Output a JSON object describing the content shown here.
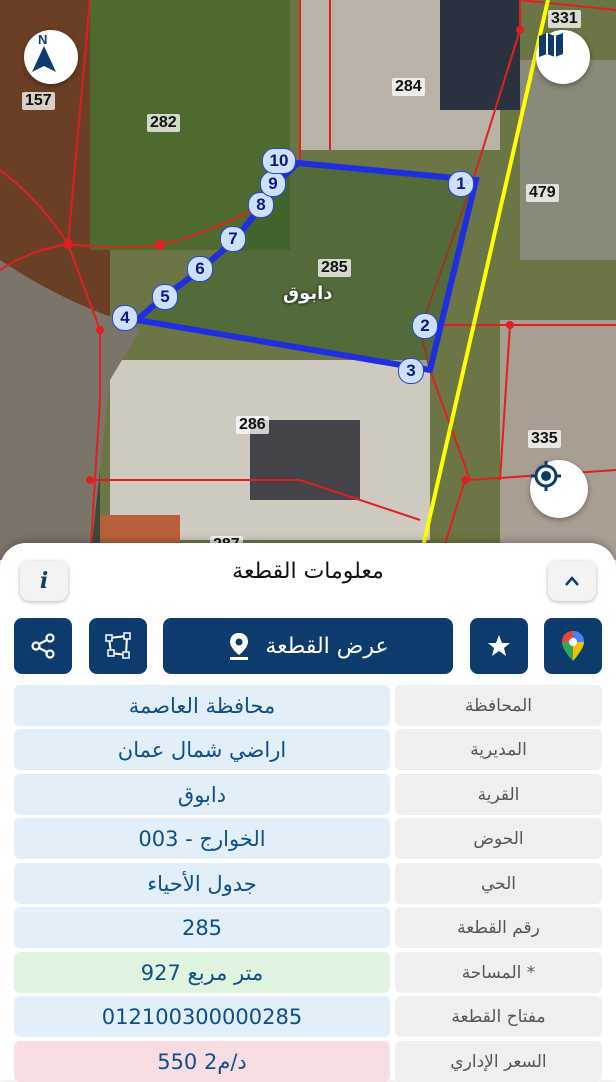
{
  "map": {
    "plot_numbers": {
      "p331": "331",
      "p157": "157",
      "p284": "284",
      "p282": "282",
      "p479": "479",
      "p285": "285",
      "p286": "286",
      "p335": "335",
      "p287": "287"
    },
    "village_label": "دابوق",
    "vertices": [
      "1",
      "2",
      "3",
      "4",
      "5",
      "6",
      "7",
      "8",
      "9",
      "10"
    ],
    "north_label": "N",
    "colors": {
      "boundary": "#1f2fe0",
      "parcel_lines": "#e02020",
      "road": "#ffff00"
    }
  },
  "panel": {
    "title": "معلومات القطعة",
    "info_icon": "i",
    "show_plot_label": "عرض القطعة",
    "icons": [
      "share-icon",
      "polygon-icon",
      "location-pin-icon",
      "star-icon",
      "google-maps-icon",
      "chevron-up-icon",
      "info-icon"
    ],
    "rows": [
      {
        "label": "المحافظة",
        "value": "محافظة العاصمة",
        "color": "#e2eef8"
      },
      {
        "label": "المديرية",
        "value": "اراضي شمال عمان",
        "color": "#e2eef8"
      },
      {
        "label": "القرية",
        "value": "دابوق",
        "color": "#e2eef8"
      },
      {
        "label": "الحوض",
        "value": "الخوارج - 003",
        "color": "#e2eef8"
      },
      {
        "label": "الحي",
        "value": "جدول الأحياء",
        "color": "#e2eef8"
      },
      {
        "label": "رقم القطعة",
        "value": "285",
        "color": "#e2eef8"
      },
      {
        "label": "المساحة *",
        "value": "927  متر مربع",
        "color": "#e0f3df"
      },
      {
        "label": "مفتاح القطعة",
        "value": "012100300000285",
        "color": "#e2eef8"
      },
      {
        "label": "السعر الإداري",
        "value": "550 د/م2",
        "color": "#f7dde2"
      }
    ]
  }
}
